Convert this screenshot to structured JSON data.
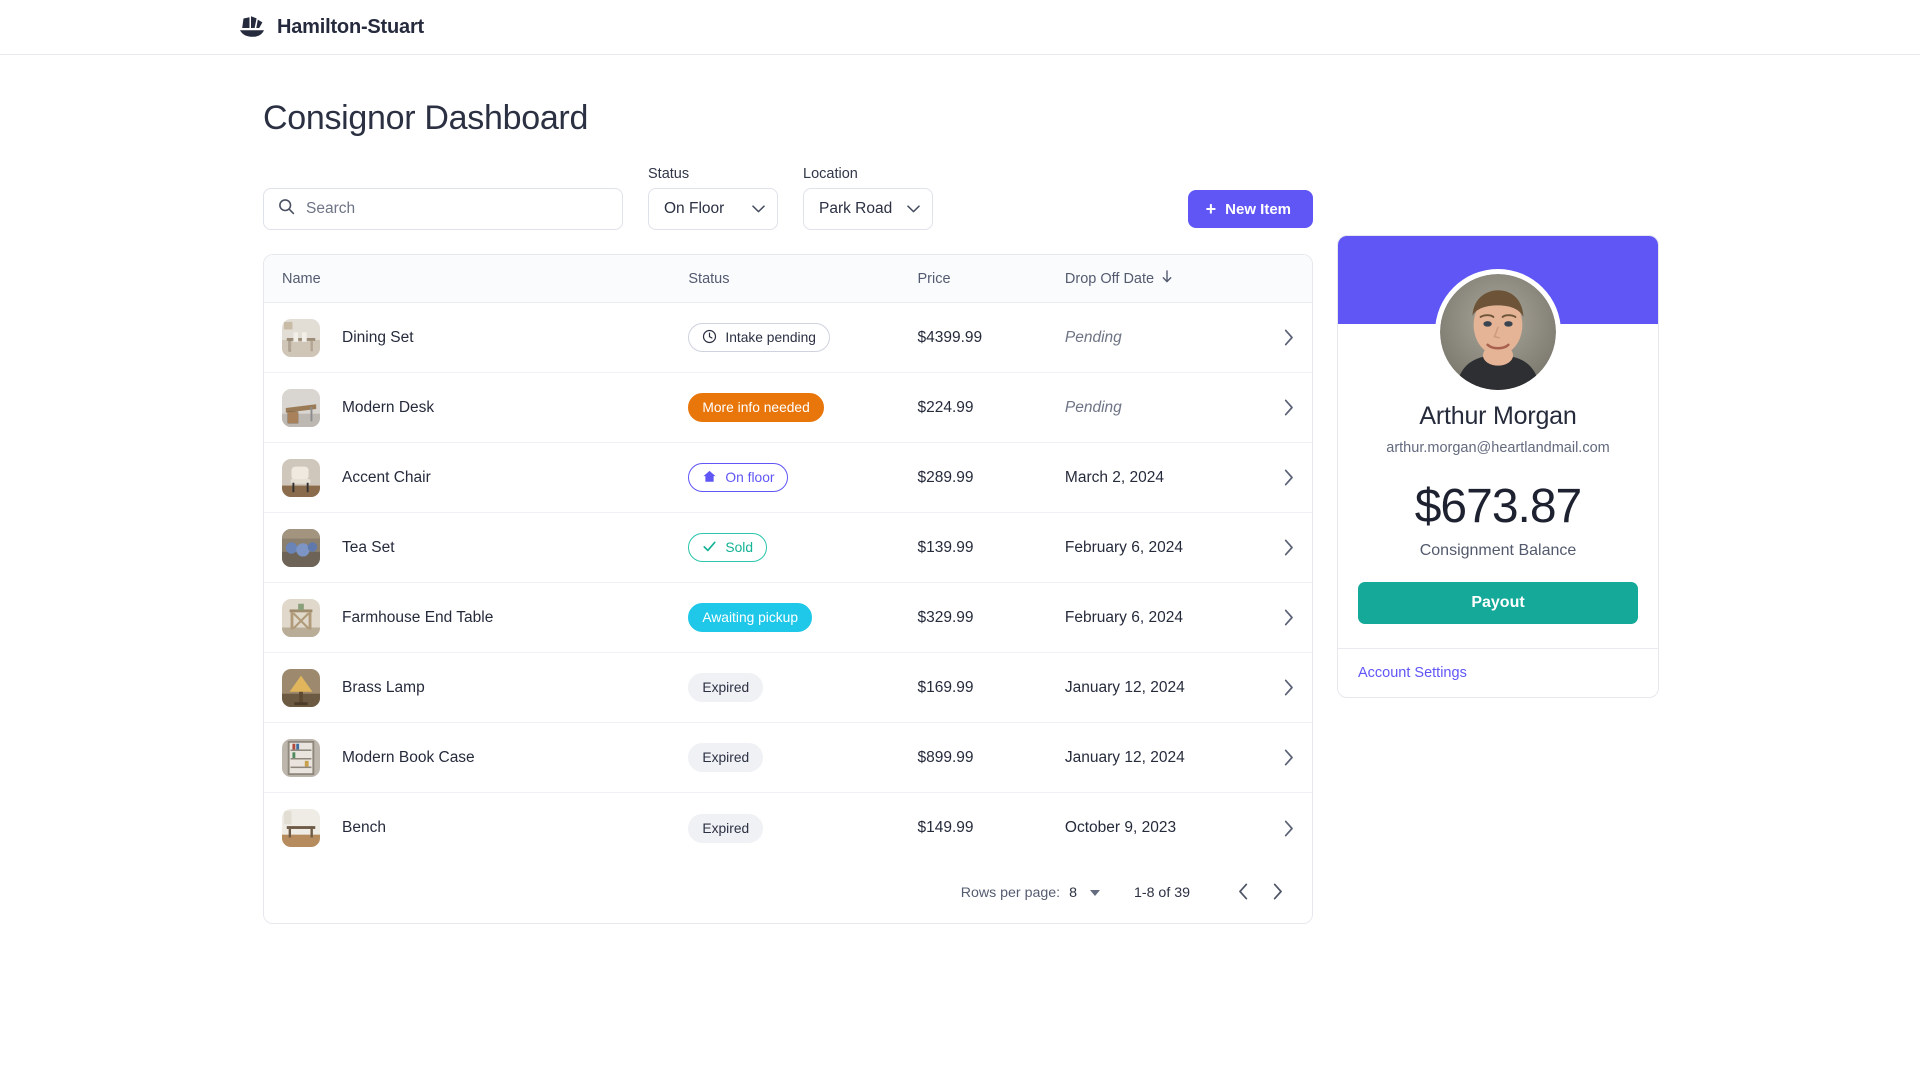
{
  "brand": {
    "name": "Hamilton-Stuart",
    "logo_icon": "sailboat-icon"
  },
  "page": {
    "title": "Consignor Dashboard"
  },
  "filters": {
    "search": {
      "placeholder": "Search",
      "value": "",
      "icon": "search-icon"
    },
    "status": {
      "label": "Status",
      "value": "On Floor",
      "icon": "chevron-down-icon"
    },
    "location": {
      "label": "Location",
      "value": "Park Road",
      "icon": "chevron-down-icon"
    },
    "new_item_button": {
      "label": "New Item",
      "icon": "plus-icon"
    }
  },
  "table": {
    "columns": {
      "name": "Name",
      "status": "Status",
      "price": "Price",
      "date": "Drop Off Date",
      "sort_icon": "arrow-down-icon"
    },
    "rows": [
      {
        "name": "Dining Set",
        "status": "Intake pending",
        "status_style": "outline-gray",
        "status_icon": "clock-icon",
        "price": "$4399.99",
        "date": "Pending",
        "date_pending": true,
        "thumb": "dining-set-photo"
      },
      {
        "name": "Modern Desk",
        "status": "More info needed",
        "status_style": "filled-orange",
        "status_icon": "",
        "price": "$224.99",
        "date": "Pending",
        "date_pending": true,
        "thumb": "modern-desk-photo"
      },
      {
        "name": "Accent Chair",
        "status": "On floor",
        "status_style": "outline-purple",
        "status_icon": "home-icon",
        "price": "$289.99",
        "date": "March 2, 2024",
        "date_pending": false,
        "thumb": "accent-chair-photo"
      },
      {
        "name": "Tea Set",
        "status": "Sold",
        "status_style": "outline-teal",
        "status_icon": "check-icon",
        "price": "$139.99",
        "date": "February 6, 2024",
        "date_pending": false,
        "thumb": "tea-set-photo"
      },
      {
        "name": "Farmhouse End Table",
        "status": "Awaiting pickup",
        "status_style": "filled-cyan",
        "status_icon": "",
        "price": "$329.99",
        "date": "February 6, 2024",
        "date_pending": false,
        "thumb": "farmhouse-end-table-photo"
      },
      {
        "name": "Brass Lamp",
        "status": "Expired",
        "status_style": "soft-gray",
        "status_icon": "",
        "price": "$169.99",
        "date": "January 12, 2024",
        "date_pending": false,
        "thumb": "brass-lamp-photo"
      },
      {
        "name": "Modern Book Case",
        "status": "Expired",
        "status_style": "soft-gray",
        "status_icon": "",
        "price": "$899.99",
        "date": "January 12, 2024",
        "date_pending": false,
        "thumb": "modern-book-case-photo"
      },
      {
        "name": "Bench",
        "status": "Expired",
        "status_style": "soft-gray",
        "status_icon": "",
        "price": "$149.99",
        "date": "October 9, 2023",
        "date_pending": false,
        "thumb": "bench-photo"
      }
    ],
    "pagination": {
      "rows_per_page_label": "Rows per page:",
      "rows_per_page_value": "8",
      "range": "1-8 of 39",
      "prev_icon": "chevron-left-icon",
      "next_icon": "chevron-right-icon"
    }
  },
  "profile": {
    "name": "Arthur Morgan",
    "email": "arthur.morgan@heartlandmail.com",
    "balance": "$673.87",
    "balance_label": "Consignment Balance",
    "payout_label": "Payout",
    "account_settings_label": "Account Settings",
    "avatar_alt": "arthur-morgan-avatar"
  },
  "colors": {
    "accent_purple": "#6056f6",
    "payout_teal": "#14a998",
    "orange": "#e8760a",
    "cyan": "#1fc8e8",
    "sold_teal": "#13b395"
  }
}
